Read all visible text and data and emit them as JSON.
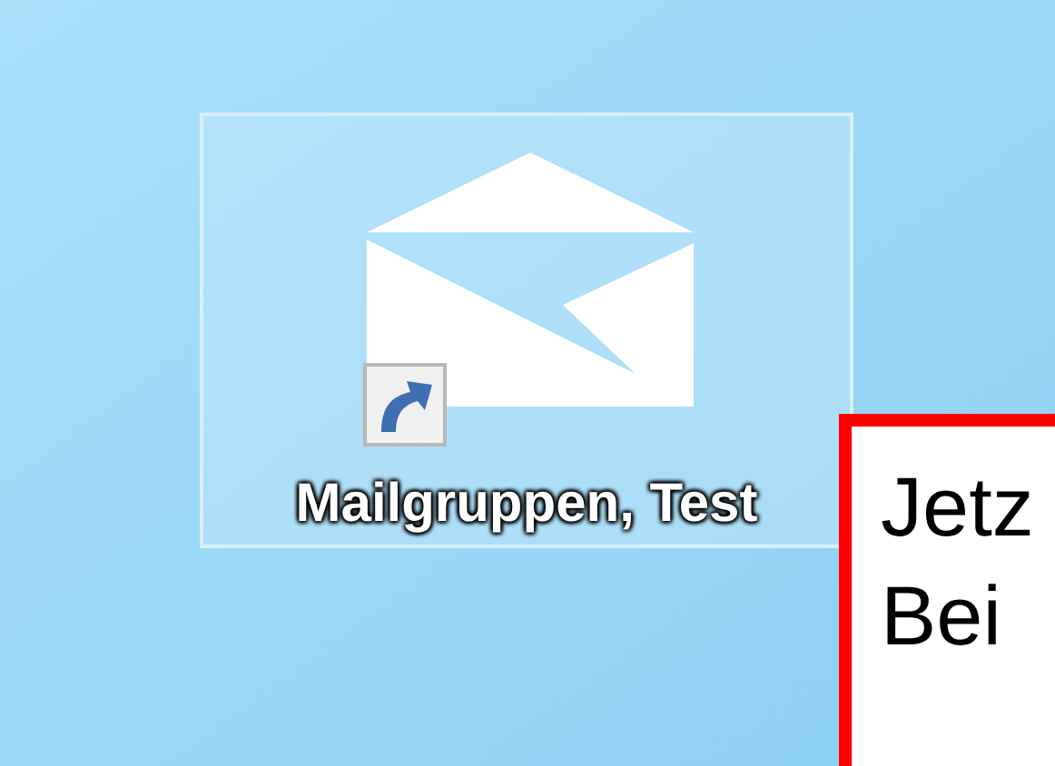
{
  "desktop_icon": {
    "label": "Mailgruppen, Test",
    "selected": true,
    "shortcut": true
  },
  "callout": {
    "lines": [
      "Jetz",
      "Bei"
    ]
  }
}
